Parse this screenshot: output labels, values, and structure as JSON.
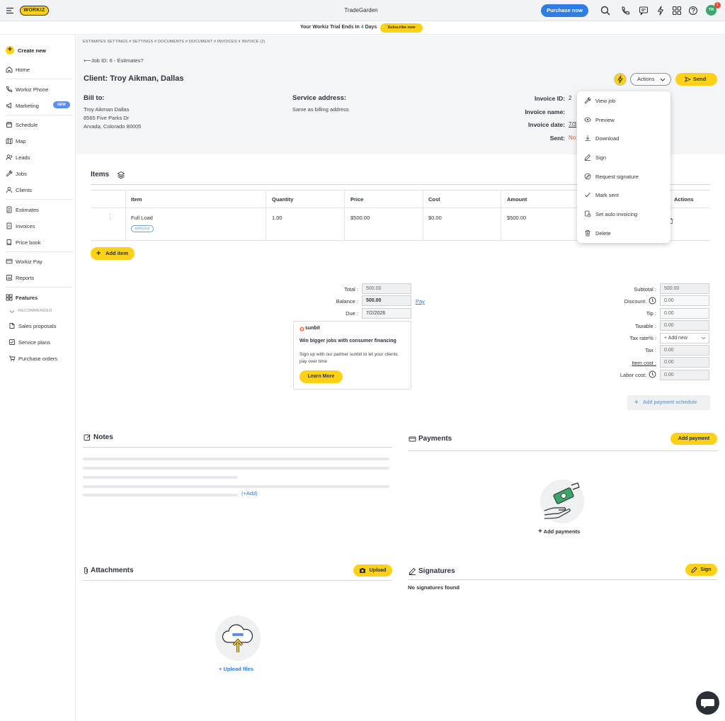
{
  "topbar": {
    "logo": "WORKIZ",
    "company": "TradeGarden",
    "purchase_label": "Purchase now",
    "avatar_initials": "TR",
    "notif_count": "1",
    "icons": [
      "search-icon",
      "phone-icon",
      "message-icon",
      "bolt-icon",
      "apps-grid-icon",
      "help-icon"
    ]
  },
  "trial": {
    "text_prefix": "Your Workiz Trial Ends In",
    "days": "4",
    "text_suffix": "Days",
    "subscribe_label": "Subscribe now"
  },
  "sidebar": {
    "create_new": "Create new",
    "items": [
      {
        "label": "Home",
        "icon": "home-icon"
      },
      {
        "label": "Workiz Phone",
        "icon": "phone-icon"
      },
      {
        "label": "Marketing",
        "icon": "megaphone-icon",
        "badge": "NEW"
      },
      {
        "label": "Schedule",
        "icon": "calendar-icon"
      },
      {
        "label": "Map",
        "icon": "map-icon"
      },
      {
        "label": "Leads",
        "icon": "leads-icon"
      },
      {
        "label": "Jobs",
        "icon": "wrench-icon"
      },
      {
        "label": "Clients",
        "icon": "clients-icon"
      },
      {
        "label": "Estimates",
        "icon": "estimate-icon"
      },
      {
        "label": "Invoices",
        "icon": "invoice-icon"
      },
      {
        "label": "Price book",
        "icon": "book-icon"
      },
      {
        "label": "Workiz Pay",
        "icon": "card-icon"
      },
      {
        "label": "Reports",
        "icon": "report-icon"
      },
      {
        "label": "Features",
        "icon": "features-grid-icon"
      },
      {
        "label": "Sales proposals",
        "icon": "proposal-icon"
      },
      {
        "label": "Service plans",
        "icon": "service-plan-icon"
      },
      {
        "label": "Purchase orders",
        "icon": "purchase-order-icon"
      }
    ],
    "recommended": "RECOMMENDED"
  },
  "breadcrumb": "ESTIMATES SETTINGS # SETTINGS # DOCUMENTS # DOCUMENT # INVOICES # INVOICE (2)",
  "job_link": "Job ID: 6 - Estimates?",
  "client": {
    "prefix": "Client:",
    "name": "Troy Aikman, Dallas"
  },
  "buttons": {
    "actions": "Actions",
    "send": "Send"
  },
  "bill_to": {
    "title": "Bill to:",
    "name": "Troy Aikman Dallas",
    "street": "8565 Five Parks Dr",
    "city": "Arvada, Colorado 80005"
  },
  "service_address": {
    "title": "Service address:",
    "value": "Same as billing address"
  },
  "invoice_info": {
    "id_label": "Invoice ID:",
    "id_value": "2",
    "name_label": "Invoice name:",
    "date_label": "Invoice date:",
    "date_value": "7/3",
    "sent_label": "Sent:",
    "sent_value": "No"
  },
  "actions_menu": [
    {
      "label": "View job",
      "icon": "wrench-icon"
    },
    {
      "label": "Preview",
      "icon": "eye-icon"
    },
    {
      "label": "Download",
      "icon": "download-icon"
    },
    {
      "label": "Sign",
      "icon": "pen-icon"
    },
    {
      "label": "Request signature",
      "icon": "signature-request-icon"
    },
    {
      "label": "Mark sent",
      "icon": "check-icon"
    },
    {
      "label": "Set auto invoicing",
      "icon": "auto-invoice-icon"
    },
    {
      "label": "Delete",
      "icon": "trash-icon"
    }
  ],
  "items": {
    "title": "Items",
    "columns": [
      "Item",
      "Quantity",
      "Price",
      "Cost",
      "Amount",
      "Actions"
    ],
    "rows": [
      {
        "name": "Full Load",
        "tag": "SERVICE",
        "quantity": "1.00",
        "price": "$500.00",
        "cost": "$0.00",
        "amount": "$500.00"
      }
    ],
    "add_label": "Add item"
  },
  "totals_left": {
    "total_label": "Total :",
    "total_value": "500.00",
    "balance_label": "Balance :",
    "balance_value": "500.00",
    "due_label": "Due :",
    "due_value": "7/2/2026",
    "pay_link": "Pay"
  },
  "sunbit": {
    "logo": "sunbit",
    "headline": "Win bigger jobs with consumer financing",
    "body": "Sign up with our partner sunbit to let your clients pay over time",
    "button": "Learn More"
  },
  "totals_right": [
    {
      "label": "Subtotal :",
      "value": "500.00"
    },
    {
      "label": "Discount:",
      "value": "0.00",
      "info": true
    },
    {
      "label": "Tip :",
      "value": "0.00"
    },
    {
      "label": "Taxable :",
      "value": "0.00"
    },
    {
      "label": "Tax rate% :",
      "value": "+ Add new"
    },
    {
      "label": "Tax :",
      "value": "0.00"
    },
    {
      "label": "Item cost :",
      "value": "0.00"
    },
    {
      "label": "Labor cost:",
      "value": "0.00",
      "info": true
    }
  ],
  "add_payment_schedule": "Add payment schedule",
  "notes": {
    "title": "Notes",
    "add_link": "(+Add)"
  },
  "payments": {
    "title": "Payments",
    "add_button": "Add payment",
    "add_link": "Add payments"
  },
  "attachments": {
    "title": "Attachments",
    "upload_button": "Upload",
    "upload_link": "+ Upload files"
  },
  "signatures": {
    "title": "Signatures",
    "sign_button": "Sign",
    "empty": "No signatures found"
  },
  "colors": {
    "brand_yellow": "#fcd116",
    "primary_blue": "#2f7de1",
    "danger_red": "#e74c3c",
    "green": "#3aa66a"
  }
}
